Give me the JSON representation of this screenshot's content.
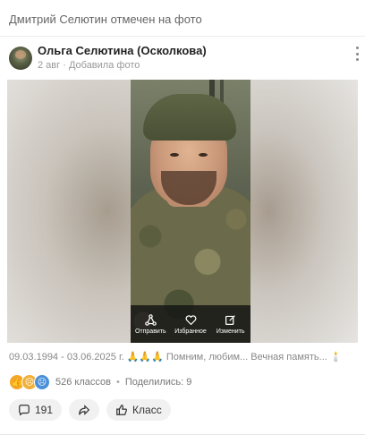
{
  "header": {
    "tagged_text": "Дмитрий Селютин отмечен на фото"
  },
  "post": {
    "author": "Ольга Селютина (Осколкова)",
    "date": "2 авг",
    "action": "Добавила фото",
    "caption": "09.03.1994 - 03.06.2025 г. 🙏🙏🙏 Помним, любим... Вечная память... 🕯️"
  },
  "photo_actions": [
    {
      "label": "Отправить",
      "icon": "share-icon"
    },
    {
      "label": "Избранное",
      "icon": "heart-icon"
    },
    {
      "label": "Изменить",
      "icon": "edit-icon"
    }
  ],
  "reactions": {
    "icons": [
      "thumbs-up-icon",
      "sad-face-icon",
      "crying-face-icon"
    ],
    "count_text": "526 классов",
    "shares_text": "Поделились: 9"
  },
  "buttons": {
    "comments_count": "191",
    "klass_label": "Класс"
  },
  "colors": {
    "accent": "#f5a623",
    "button_bg": "#f1f1f1",
    "overlay": "#141414"
  }
}
